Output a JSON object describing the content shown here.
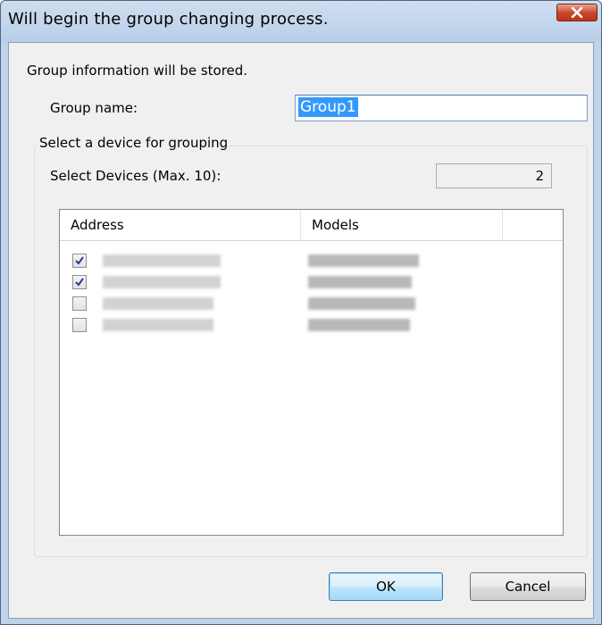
{
  "window": {
    "title": "Will begin the group changing process."
  },
  "info_text": "Group information will be stored.",
  "group_name": {
    "label": "Group name:",
    "value": "Group1"
  },
  "device_group": {
    "legend": "Select a device for grouping",
    "select_label": "Select Devices (Max. 10):",
    "count": "2",
    "columns": [
      "Address",
      "Models"
    ],
    "rows": [
      {
        "checked": true
      },
      {
        "checked": true
      },
      {
        "checked": false
      },
      {
        "checked": false
      }
    ]
  },
  "buttons": {
    "ok": "OK",
    "cancel": "Cancel"
  },
  "icons": {
    "close": "close-icon",
    "checkmark": "checkmark-icon"
  },
  "colors": {
    "title_bar": "#bfd3ea",
    "close_button": "#c7432a",
    "selection": "#3399ff",
    "checkmark": "#1e3f8a"
  }
}
